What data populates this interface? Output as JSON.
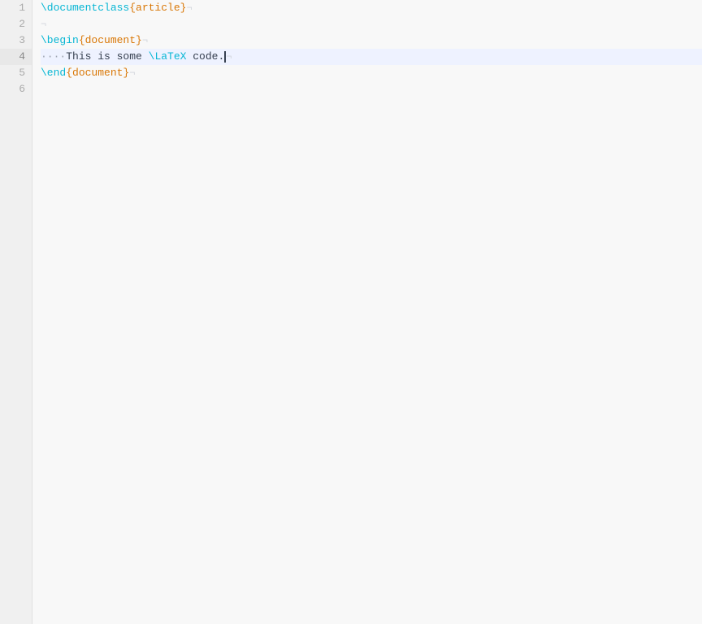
{
  "editor": {
    "background": "#f8f8f8",
    "active_line": 4,
    "lines": [
      {
        "number": 1,
        "parts": [
          {
            "type": "cmd-doc",
            "text": "\\documentclass"
          },
          {
            "type": "brace-content",
            "text": "{article}"
          },
          {
            "type": "pilcrow",
            "text": "¬"
          }
        ],
        "empty": false
      },
      {
        "number": 2,
        "parts": [
          {
            "type": "pilcrow",
            "text": "¬"
          }
        ],
        "empty": true
      },
      {
        "number": 3,
        "parts": [
          {
            "type": "cmd-begin",
            "text": "\\begin"
          },
          {
            "type": "brace-content",
            "text": "{document}"
          },
          {
            "type": "pilcrow",
            "text": "¬"
          }
        ],
        "empty": false
      },
      {
        "number": 4,
        "parts": [
          {
            "type": "comment-dots",
            "text": "····"
          },
          {
            "type": "plain-text",
            "text": "This is some "
          },
          {
            "type": "cmd-latex",
            "text": "\\LaTeX"
          },
          {
            "type": "plain-text",
            "text": " code."
          },
          {
            "type": "cursor",
            "text": ""
          },
          {
            "type": "pilcrow",
            "text": "¬"
          }
        ],
        "empty": false,
        "active": true
      },
      {
        "number": 5,
        "parts": [
          {
            "type": "cmd-end",
            "text": "\\end"
          },
          {
            "type": "brace-content",
            "text": "{document}"
          },
          {
            "type": "pilcrow",
            "text": "¬"
          }
        ],
        "empty": false
      },
      {
        "number": 6,
        "parts": [],
        "empty": true
      }
    ],
    "total_lines": 6
  }
}
